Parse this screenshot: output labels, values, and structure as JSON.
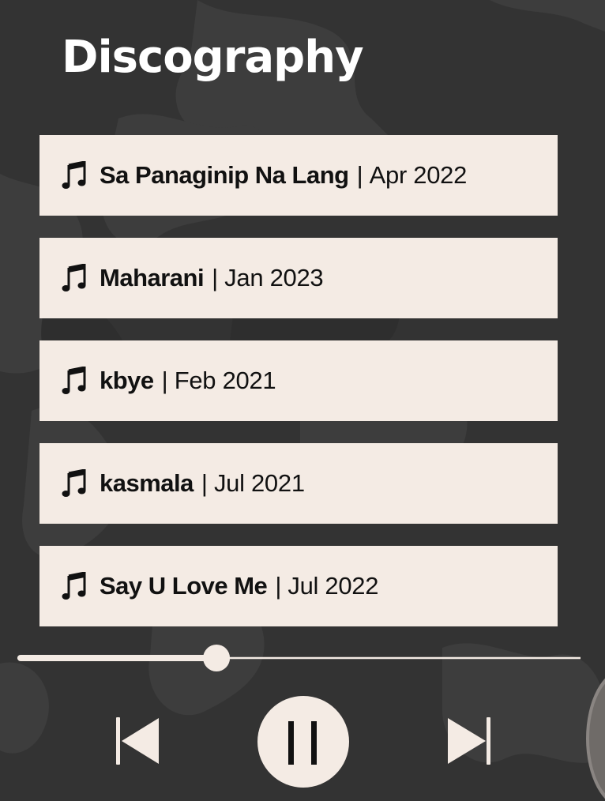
{
  "page": {
    "title": "Discography"
  },
  "tracks": [
    {
      "name": "Sa Panaginip Na Lang",
      "separator": "|",
      "date": "Apr 2022",
      "icon": "music-note-icon"
    },
    {
      "name": "Maharani",
      "separator": "|",
      "date": "Jan 2023",
      "icon": "music-note-icon"
    },
    {
      "name": "kbye",
      "separator": "|",
      "date": "Feb 2021",
      "icon": "music-note-icon"
    },
    {
      "name": "kasmala",
      "separator": "|",
      "date": "Jul 2021",
      "icon": "music-note-icon"
    },
    {
      "name": "Say U Love Me",
      "separator": "|",
      "date": "Jul 2022",
      "icon": "music-note-icon"
    }
  ],
  "player": {
    "progress": 0.35,
    "state": "playing",
    "controls": [
      "skip-previous-icon",
      "pause-icon",
      "skip-next-icon"
    ]
  },
  "colors": {
    "background": "#333333",
    "card": "#f4ebe4",
    "text": "#111111",
    "accent": "#f4ebe4"
  }
}
